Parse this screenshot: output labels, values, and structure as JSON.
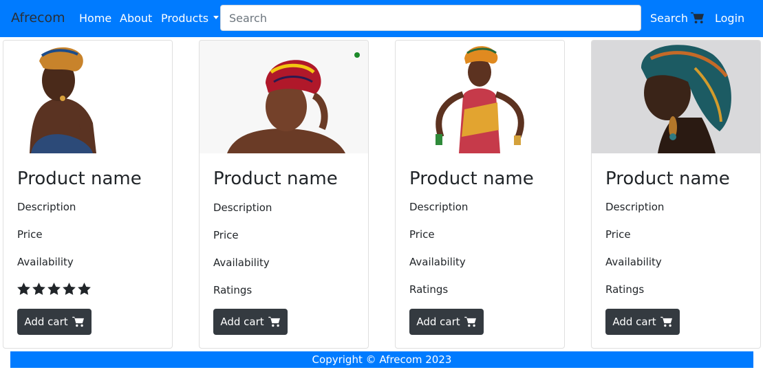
{
  "nav": {
    "brand": "Afrecom",
    "home": "Home",
    "about": "About",
    "products": "Products",
    "search_placeholder": "Search",
    "search_label": "Search",
    "login": "Login"
  },
  "products": [
    {
      "title": "Product name",
      "description": "Description",
      "price": "Price",
      "availability": "Availability",
      "rating_stars": 5,
      "button": "Add cart"
    },
    {
      "title": "Product name",
      "description": "Description",
      "price": "Price",
      "availability": "Availability",
      "ratings": "Ratings",
      "button": "Add cart"
    },
    {
      "title": "Product name",
      "description": "Description",
      "price": "Price",
      "availability": "Availability",
      "ratings": "Ratings",
      "button": "Add cart"
    },
    {
      "title": "Product name",
      "description": "Description",
      "price": "Price",
      "availability": "Availability",
      "ratings": "Ratings",
      "button": "Add cart"
    }
  ],
  "footer": {
    "copyright": "Copyright © Afrecom 2023"
  },
  "colors": {
    "primary": "#007bff",
    "dark": "#343a40",
    "text": "#212529"
  },
  "icons": {
    "cart": "cart-icon",
    "star": "star-icon"
  }
}
